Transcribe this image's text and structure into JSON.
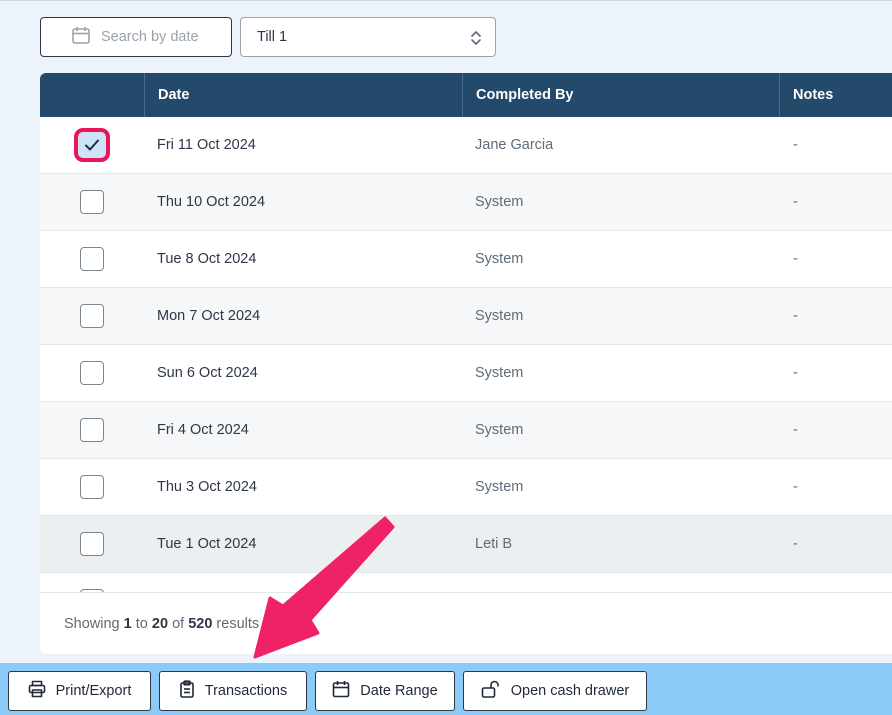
{
  "filters": {
    "date_placeholder": "Search by date",
    "till_value": "Till 1"
  },
  "table": {
    "columns": [
      "",
      "Date",
      "Completed By",
      "Notes"
    ],
    "rows": [
      {
        "date": "Fri 11 Oct 2024",
        "completed_by": "Jane Garcia",
        "notes": "-",
        "checked": true
      },
      {
        "date": "Thu 10 Oct 2024",
        "completed_by": "System",
        "notes": "-",
        "checked": false
      },
      {
        "date": "Tue 8 Oct 2024",
        "completed_by": "System",
        "notes": "-",
        "checked": false
      },
      {
        "date": "Mon 7 Oct 2024",
        "completed_by": "System",
        "notes": "-",
        "checked": false
      },
      {
        "date": "Sun 6 Oct 2024",
        "completed_by": "System",
        "notes": "-",
        "checked": false
      },
      {
        "date": "Fri 4 Oct 2024",
        "completed_by": "System",
        "notes": "-",
        "checked": false
      },
      {
        "date": "Thu 3 Oct 2024",
        "completed_by": "System",
        "notes": "-",
        "checked": false
      },
      {
        "date": "Tue 1 Oct 2024",
        "completed_by": "Leti B",
        "notes": "-",
        "checked": false
      }
    ]
  },
  "pagination": {
    "prefix": "Showing",
    "from": "1",
    "to_word": "to",
    "to": "20",
    "of_word": "of",
    "total": "520",
    "suffix": "results"
  },
  "toolbar": {
    "print_label": "Print/Export",
    "transactions_label": "Transactions",
    "date_range_label": "Date Range",
    "open_drawer_label": "Open cash drawer"
  },
  "colors": {
    "header_bg": "#23496b",
    "toolbar_bg": "#8ccaf8",
    "highlight": "#e8145c"
  },
  "icons": {
    "date": "calendar-icon",
    "till": "chevron-updown-icon",
    "print": "printer-icon",
    "transactions": "clipboard-icon",
    "date_range": "calendar-icon",
    "drawer": "unlock-icon",
    "check": "checkmark-icon"
  }
}
